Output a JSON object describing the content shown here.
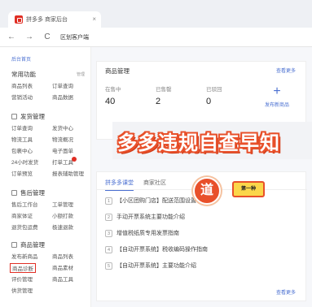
{
  "browser": {
    "tab_title": "拼多多 商家后台",
    "tab_close": "×",
    "back": "←",
    "forward": "→",
    "reload": "C",
    "address": "区划客户端"
  },
  "sidebar": {
    "top_link": "后台首页",
    "sections": [
      {
        "title": "常用功能",
        "tag": "管理",
        "items": [
          "商品列表",
          "订单查询",
          "营销活动",
          "商品数据"
        ]
      },
      {
        "title": "发货管理",
        "items": [
          "订单查询",
          "发货中心",
          "物流工具",
          "物流概况",
          "包裹中心",
          "电子面单",
          "24小时发货",
          "打单工具",
          "订单预览",
          "报表辅助管理"
        ]
      },
      {
        "title": "售后管理",
        "items": [
          "售后工作台",
          "工单管理",
          "商家体证",
          "小额打款",
          "退货包运费",
          "极速退款"
        ]
      },
      {
        "title": "商品管理",
        "items": [
          "发布新商品",
          "商品列表",
          "商品诊断",
          "商品素材",
          "评价管理",
          "商品工具",
          "供货管理"
        ]
      }
    ]
  },
  "goods_card": {
    "title": "商品管理",
    "more": "查看更多",
    "stats": [
      {
        "label": "在售中",
        "value": "40"
      },
      {
        "label": "已售罄",
        "value": "2"
      },
      {
        "label": "已驳回",
        "value": "0"
      }
    ],
    "publish_icon": "plus-icon",
    "publish_label": "发布新商品"
  },
  "banner": {
    "text": "多多违规自查早知",
    "circle": "道",
    "rect": "第一种"
  },
  "class_card": {
    "tab_active": "拼多多课堂",
    "tab_other": "商家社区",
    "items": [
      {
        "num": "1",
        "text": "【小区团购门店】配送范围设置"
      },
      {
        "num": "2",
        "text": "手动开票系统主要功能介绍"
      },
      {
        "num": "3",
        "text": "增值税纸质专用发票指南"
      },
      {
        "num": "4",
        "text": "【自动开票系统】税收编码操作指南"
      },
      {
        "num": "5",
        "text": "【自动开票系统】主要功能介绍"
      }
    ],
    "more": "查看更多"
  },
  "colors": {
    "accent": "#4a6fd1",
    "brand": "#e02e24",
    "banner": "#e8502a"
  }
}
